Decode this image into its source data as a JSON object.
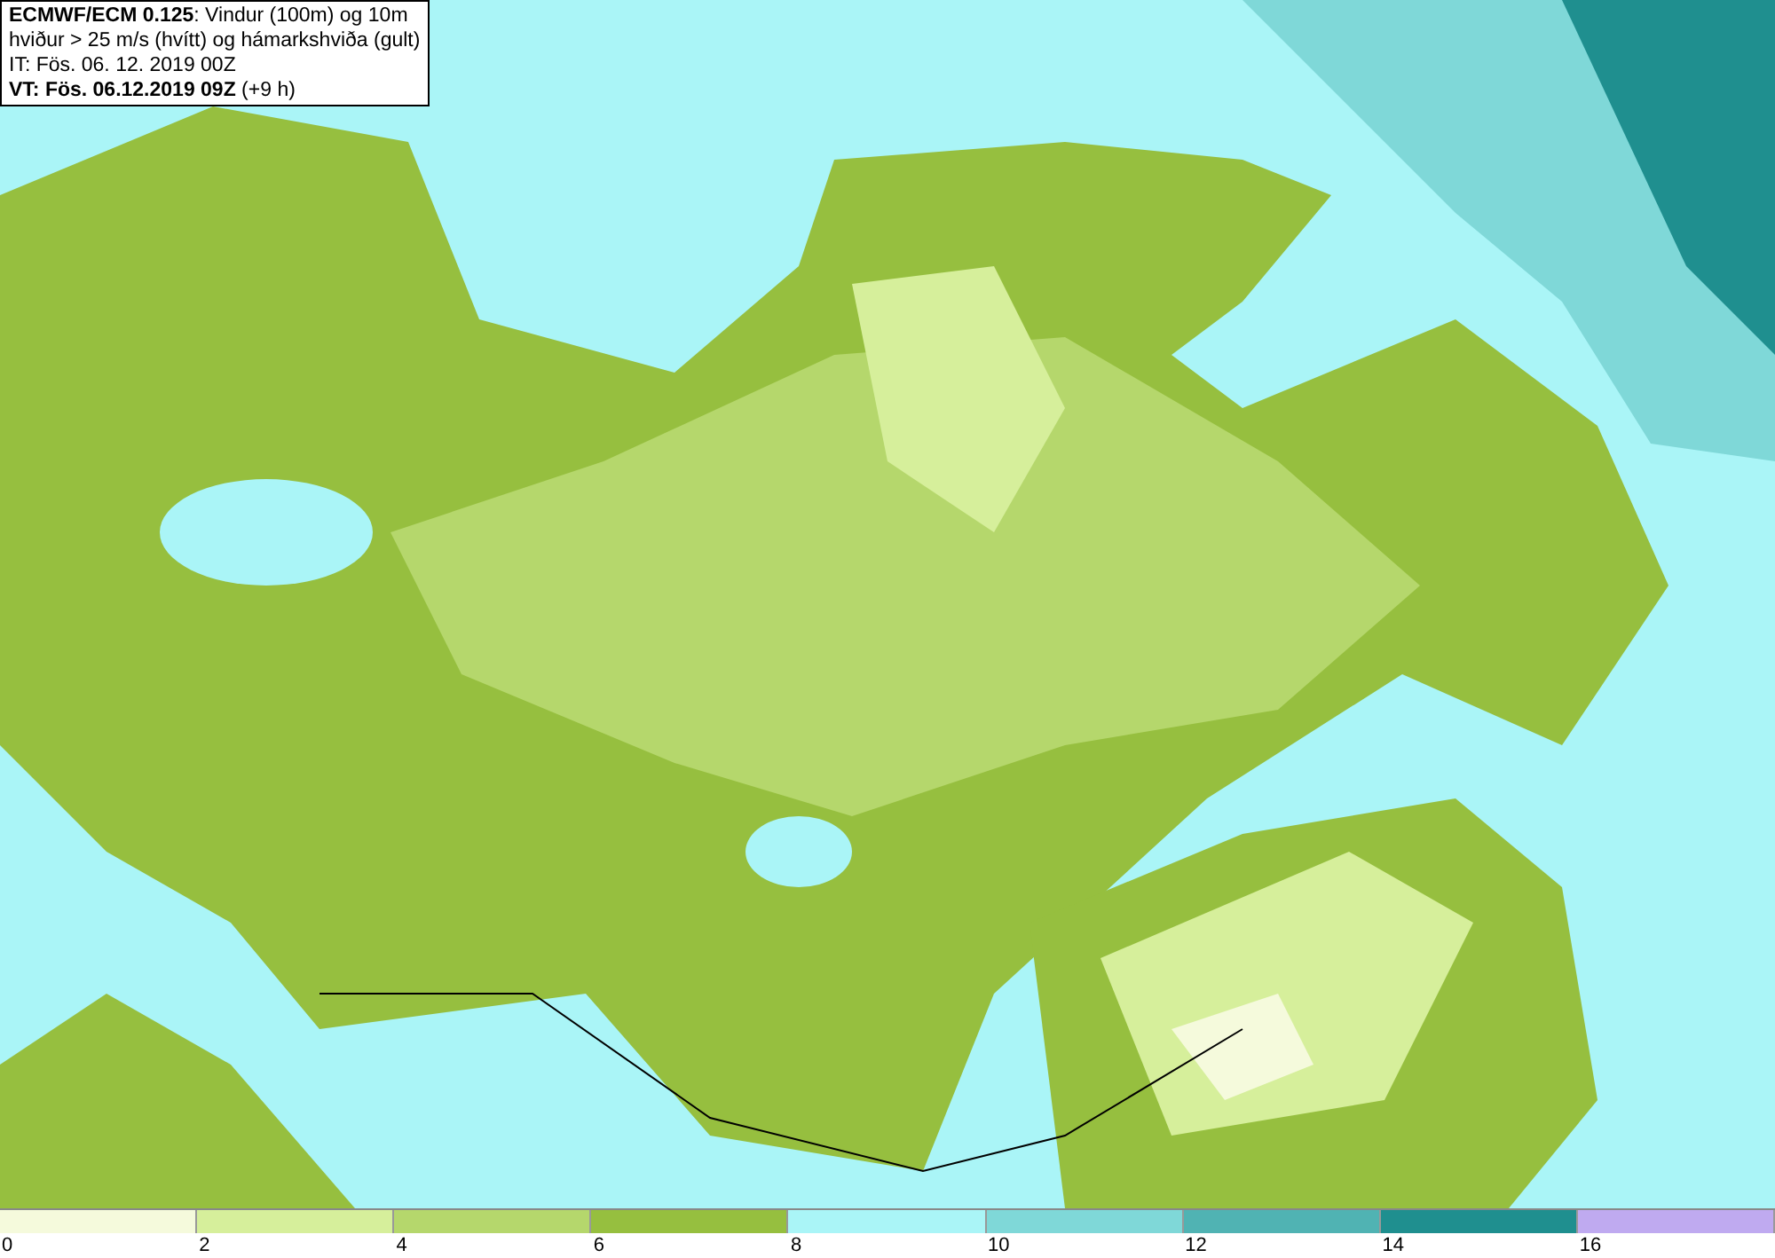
{
  "info_box": {
    "lines": [
      "**ECMWF/ECM 0.125**: Vindur (100m) og 10m",
      "hviður > 25 m/s (hvítt) og hámarkshviða (gult)",
      "IT: Fös. 06. 12. 2019 00Z",
      "**VT: Fös. 06.12.2019 09Z** (+9 h)"
    ]
  },
  "color_scale": [
    {
      "label": "0",
      "color": "#f5fadc"
    },
    {
      "label": "2",
      "color": "#d6ef9b"
    },
    {
      "label": "4",
      "color": "#b5d76c"
    },
    {
      "label": "6",
      "color": "#96bf3f"
    },
    {
      "label": "8",
      "color": "#aaf5f7"
    },
    {
      "label": "10",
      "color": "#7fd8d8"
    },
    {
      "label": "12",
      "color": "#50b3b3"
    },
    {
      "label": "14",
      "color": "#1f8f8f"
    },
    {
      "label": "16",
      "color": "#bfaaf0"
    }
  ]
}
